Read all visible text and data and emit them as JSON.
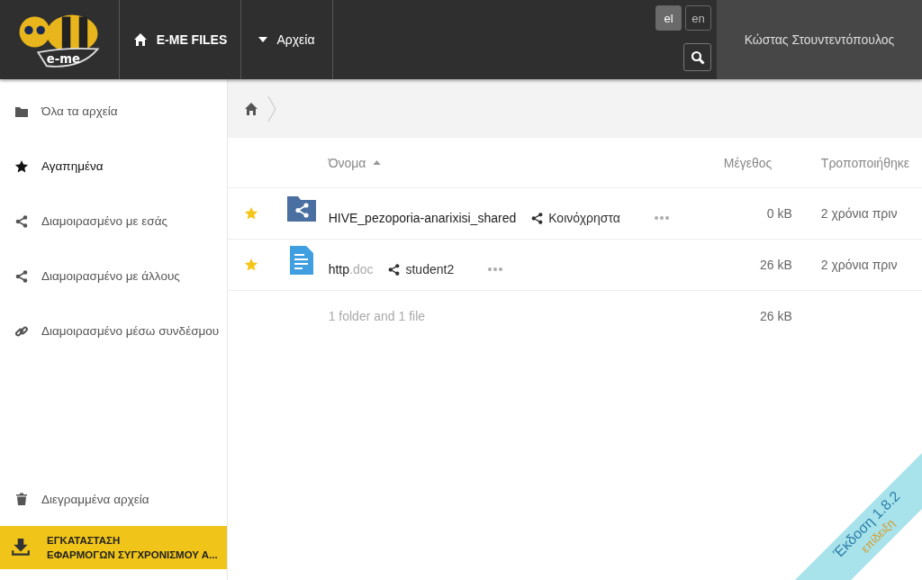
{
  "header": {
    "logo_text": "e-me",
    "app_title": "E-ME FILES",
    "menu_label": "Αρχεία",
    "languages": [
      {
        "label": "el",
        "selected": true
      },
      {
        "label": "en",
        "selected": false
      }
    ],
    "user_name": "Κώστας Στουντεντόπουλος"
  },
  "sidebar": {
    "items": [
      {
        "kind": "folder",
        "label": "Όλα τα αρχεία",
        "selected": false
      },
      {
        "kind": "star",
        "label": "Αγαπημένα",
        "selected": true
      },
      {
        "kind": "share",
        "label": "Διαμοιρασμένο με εσάς",
        "selected": false
      },
      {
        "kind": "share",
        "label": "Διαμοιρασμένο με άλλους",
        "selected": false
      },
      {
        "kind": "link",
        "label": "Διαμοιρασμένο μέσω συνδέσμου",
        "selected": false
      }
    ],
    "deleted": {
      "kind": "trash",
      "label": "Διεγραμμένα αρχεία",
      "selected": false
    },
    "install_button": {
      "line1": "ΕΓΚΑΤΑΣΤΑΣΗ",
      "line2": "ΕΦΑΡΜΟΓΩΝ ΣΥΓΧΡΟΝΙΣΜΟΥ Α..."
    }
  },
  "table": {
    "columns": [
      {
        "label": "Όνομα",
        "sorted": true
      },
      {
        "label": "Μέγεθος",
        "sorted": false
      },
      {
        "label": "Τροποποιήθηκε",
        "sorted": false
      }
    ],
    "rows": [
      {
        "favorite": true,
        "kind": "shared-folder",
        "name": "HIVE_pezoporia-anarixisi_shared",
        "extension": "",
        "share": "Κοινόχρηστα",
        "size": "0 kB",
        "modified": "2 χρόνια πριν"
      },
      {
        "favorite": true,
        "kind": "document",
        "name": "http",
        "extension": ".doc",
        "share": "student2",
        "size": "26 kB",
        "modified": "2 χρόνια πριν"
      }
    ],
    "summary": {
      "label": "1 folder and 1 file",
      "size": "26 kB"
    }
  },
  "ribbon": {
    "version": "Έκδοση 1.8.2",
    "mode": "επίδειξη"
  }
}
